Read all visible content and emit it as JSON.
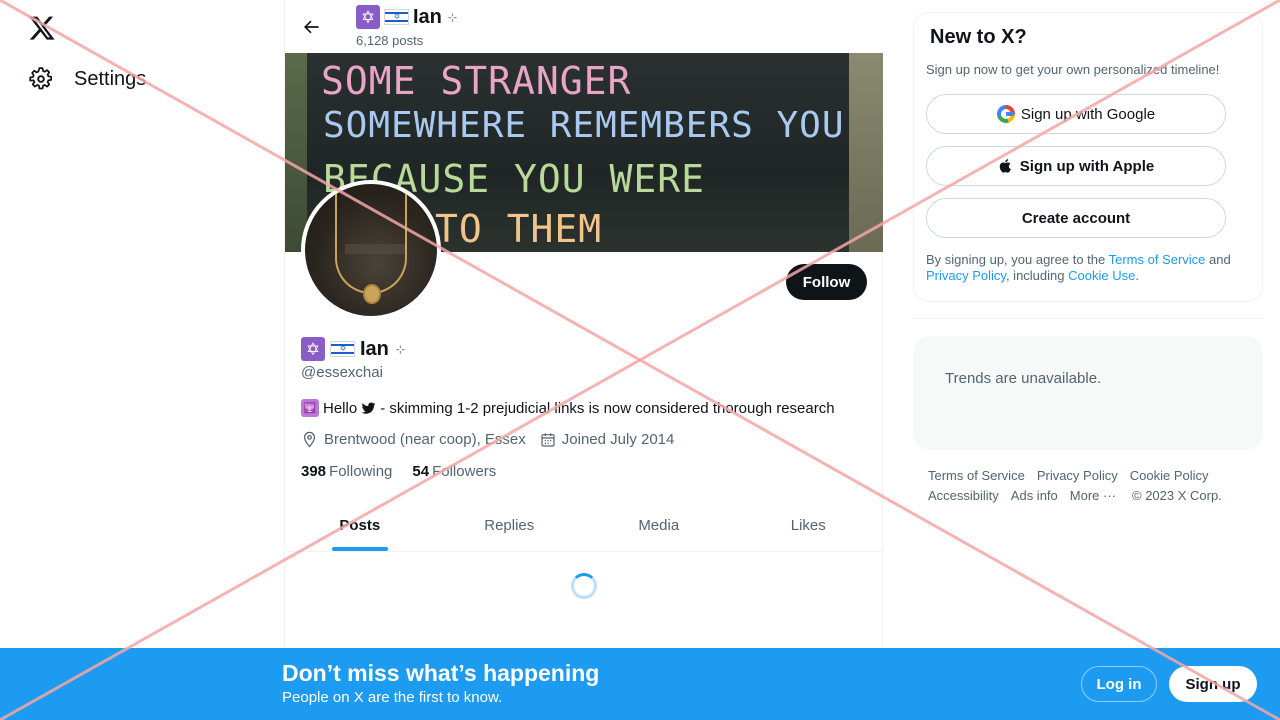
{
  "nav": {
    "logo_icon": "x-logo-icon",
    "settings_label": "Settings",
    "settings_icon": "gear-icon"
  },
  "header": {
    "name": "Ian",
    "posts_count": "6,128 posts",
    "back_icon": "arrow-left-icon"
  },
  "banner": {
    "lines": [
      "SOME STRANGER",
      "SOMEWHERE REMEMBERS YOU",
      "BECAUSE YOU WERE",
      "TO THEM"
    ]
  },
  "profile": {
    "name": "Ian",
    "handle": "@essexchai",
    "bio_prefix": "Hello",
    "bio_suffix": "- skimming 1-2 prejudicial links is now considered thorough research",
    "location": "Brentwood (near coop), Essex",
    "joined": "Joined July 2014",
    "following_count": "398",
    "following_label": "Following",
    "followers_count": "54",
    "followers_label": "Followers",
    "follow_label": "Follow"
  },
  "tabs": [
    "Posts",
    "Replies",
    "Media",
    "Likes"
  ],
  "sidebar": {
    "title": "New to X?",
    "subtitle": "Sign up now to get your own personalized timeline!",
    "google_label": "Sign up with Google",
    "apple_label": "Sign up with Apple",
    "create_label": "Create account",
    "terms_prefix": "By signing up, you agree to the ",
    "terms_link": "Terms of Service",
    "terms_and": " and ",
    "privacy_link": "Privacy Policy",
    "terms_including": ", including ",
    "cookie_link": "Cookie Use",
    "terms_end": ".",
    "trends_unavailable": "Trends are unavailable."
  },
  "footer": {
    "row1": [
      "Terms of Service",
      "Privacy Policy",
      "Cookie Policy"
    ],
    "row2": [
      "Accessibility",
      "Ads info",
      "More ···",
      "© 2023 X Corp."
    ]
  },
  "bottom_bar": {
    "title": "Don’t miss what’s happening",
    "subtitle": "People on X are the first to know.",
    "login_label": "Log in",
    "signup_label": "Sign up"
  },
  "colors": {
    "accent": "#1d9bf0",
    "text": "#0f1419",
    "muted": "#536471",
    "overlay_x": "#f4a6a6"
  }
}
